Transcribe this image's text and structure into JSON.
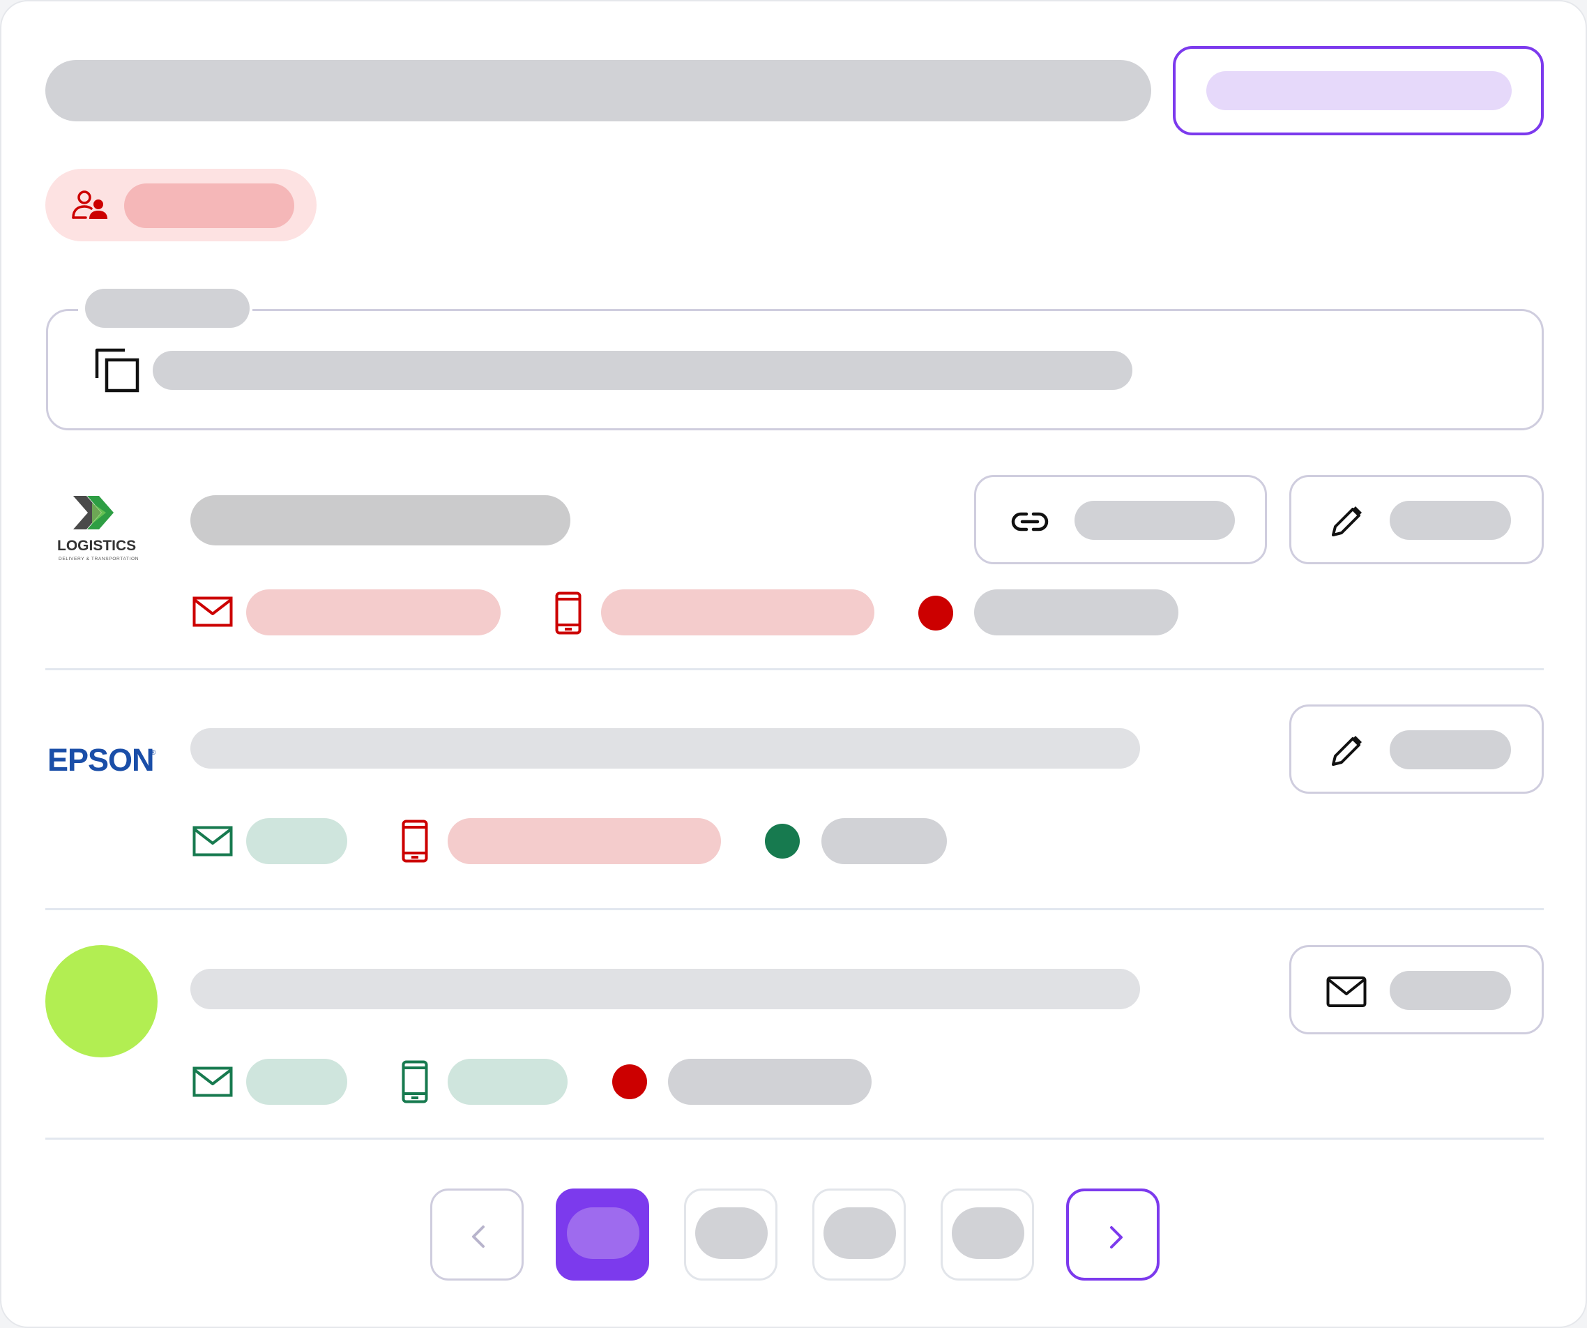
{
  "header": {
    "search_placeholder": "",
    "primary_button_label": ""
  },
  "filter_chip": {
    "icon": "user-group-icon",
    "label": ""
  },
  "share_field": {
    "legend": "",
    "value": "",
    "icon": "copy-icon"
  },
  "contacts": [
    {
      "logo_text": "LOGISTICS",
      "logo_subtext": "DELIVERY & TRANSPORTATION",
      "name": "",
      "email": "",
      "email_status": "invalid",
      "phone": "",
      "phone_status": "invalid",
      "status_color": "#cc0000",
      "status_label": "",
      "actions": [
        {
          "icon": "link-icon",
          "label": ""
        },
        {
          "icon": "pencil-icon",
          "label": ""
        }
      ]
    },
    {
      "logo_text": "EPSON",
      "name": "",
      "email": "",
      "email_status": "valid",
      "phone": "",
      "phone_status": "invalid",
      "status_color": "#177a4f",
      "status_label": "",
      "actions": [
        {
          "icon": "pencil-icon",
          "label": ""
        }
      ]
    },
    {
      "logo_text": "",
      "avatar_color": "#b2ee52",
      "name": "",
      "email": "",
      "email_status": "valid",
      "phone": "",
      "phone_status": "valid",
      "status_color": "#cc0000",
      "status_label": "",
      "actions": [
        {
          "icon": "mail-icon",
          "label": ""
        }
      ]
    }
  ],
  "pagination": {
    "prev_icon": "chevron-left-icon",
    "next_icon": "chevron-right-icon",
    "pages": [
      "",
      "",
      "",
      ""
    ],
    "active_page_index": 0
  },
  "colors": {
    "accent": "#7c3aed",
    "error": "#cc0000",
    "success": "#177a4f",
    "skeleton": "#d1d2d6"
  }
}
